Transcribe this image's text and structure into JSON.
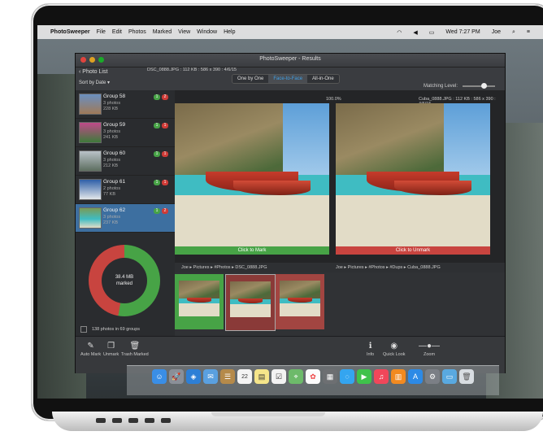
{
  "menubar": {
    "items": [
      "PhotoSweeper",
      "File",
      "Edit",
      "Photos",
      "Marked",
      "View",
      "Window",
      "Help"
    ],
    "right": [
      "Wed 7:27 PM",
      "Joe"
    ]
  },
  "window": {
    "title": "PhotoSweeper - Results",
    "back_label": "Photo List",
    "sort_label": "Sort by Date",
    "tabs": [
      "One by One",
      "Face-to-Face",
      "All-in-One"
    ],
    "active_tab": "Face-to-Face",
    "fileinfo_left": "DSC_0888.JPG : 112 KB : 586 x 390 : 4/6/15",
    "fileinfo_right": "Cuba_0888.JPG : 112 KB : 586 x 390 : 4/6/15",
    "zoom_left": "100.0%",
    "matching_label": "Matching Level:"
  },
  "groups": [
    {
      "name": "Group 58",
      "photos": "3 photos",
      "size": "228 KB",
      "green": "1",
      "red": "2"
    },
    {
      "name": "Group 59",
      "photos": "3 photos",
      "size": "241 KB",
      "green": "1",
      "red": "1"
    },
    {
      "name": "Group 60",
      "photos": "3 photos",
      "size": "212 KB",
      "green": "1",
      "red": "1"
    },
    {
      "name": "Group 61",
      "photos": "2 photos",
      "size": "77 KB",
      "green": "1",
      "red": "1"
    },
    {
      "name": "Group 62",
      "photos": "3 photos",
      "size": "237 KB",
      "green": "1",
      "red": "2"
    }
  ],
  "summary": {
    "marked_size": "38.4 MB",
    "marked_label": "marked",
    "photos_count": "138 photos in 69 groups"
  },
  "viewer": {
    "left_mark": "Click to Mark",
    "right_mark": "Click to Unmark",
    "path_left": "Joe ▸ Pictures ▸ #Photos ▸ DSC_0888.JPG",
    "path_right": "Joe ▸ Pictures ▸ #Photos ▸ #Dups ▸ Cuba_0888.JPG"
  },
  "bottombar": {
    "auto_mark": "Auto Mark",
    "unmark": "Unmark",
    "trash_marked": "Trash Marked",
    "info": "Info",
    "quick_look": "Quick Look",
    "zoom": "Zoom"
  },
  "dock": [
    "finder-icon",
    "launchpad-icon",
    "safari-icon",
    "mail-icon",
    "contacts-icon",
    "calendar-icon",
    "notes-icon",
    "reminders-icon",
    "maps-icon",
    "photos-icon",
    "photosweeper-icon",
    "messages-icon",
    "facetime-icon",
    "itunes-icon",
    "ibooks-icon",
    "appstore-icon",
    "system-prefs-icon",
    "folder-icon",
    "trash-icon"
  ],
  "calendar_day": "22"
}
